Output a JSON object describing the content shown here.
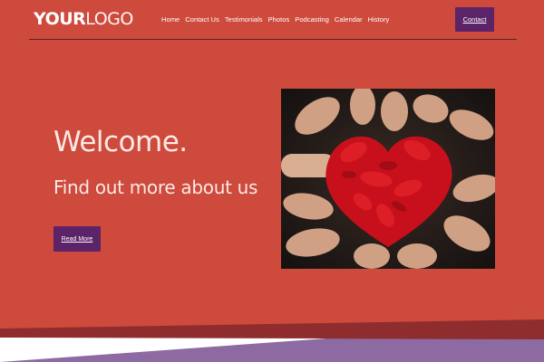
{
  "header": {
    "logo": {
      "part1": "YOUR",
      "part2": "LOGO"
    },
    "nav": [
      "Home",
      "Contact Us",
      "Testimonials",
      "Photos",
      "Podcasting",
      "Calendar",
      "History"
    ],
    "contact_label": "Contact"
  },
  "hero": {
    "title": "Welcome.",
    "subtitle": "Find out more about us",
    "button_label": "Read More"
  },
  "colors": {
    "background": "#cd4a3c",
    "button": "#5c2368",
    "wave_dark": "#8f2d2e",
    "wave_purple": "#8e6aa3",
    "text_light": "#fbe9e5"
  }
}
